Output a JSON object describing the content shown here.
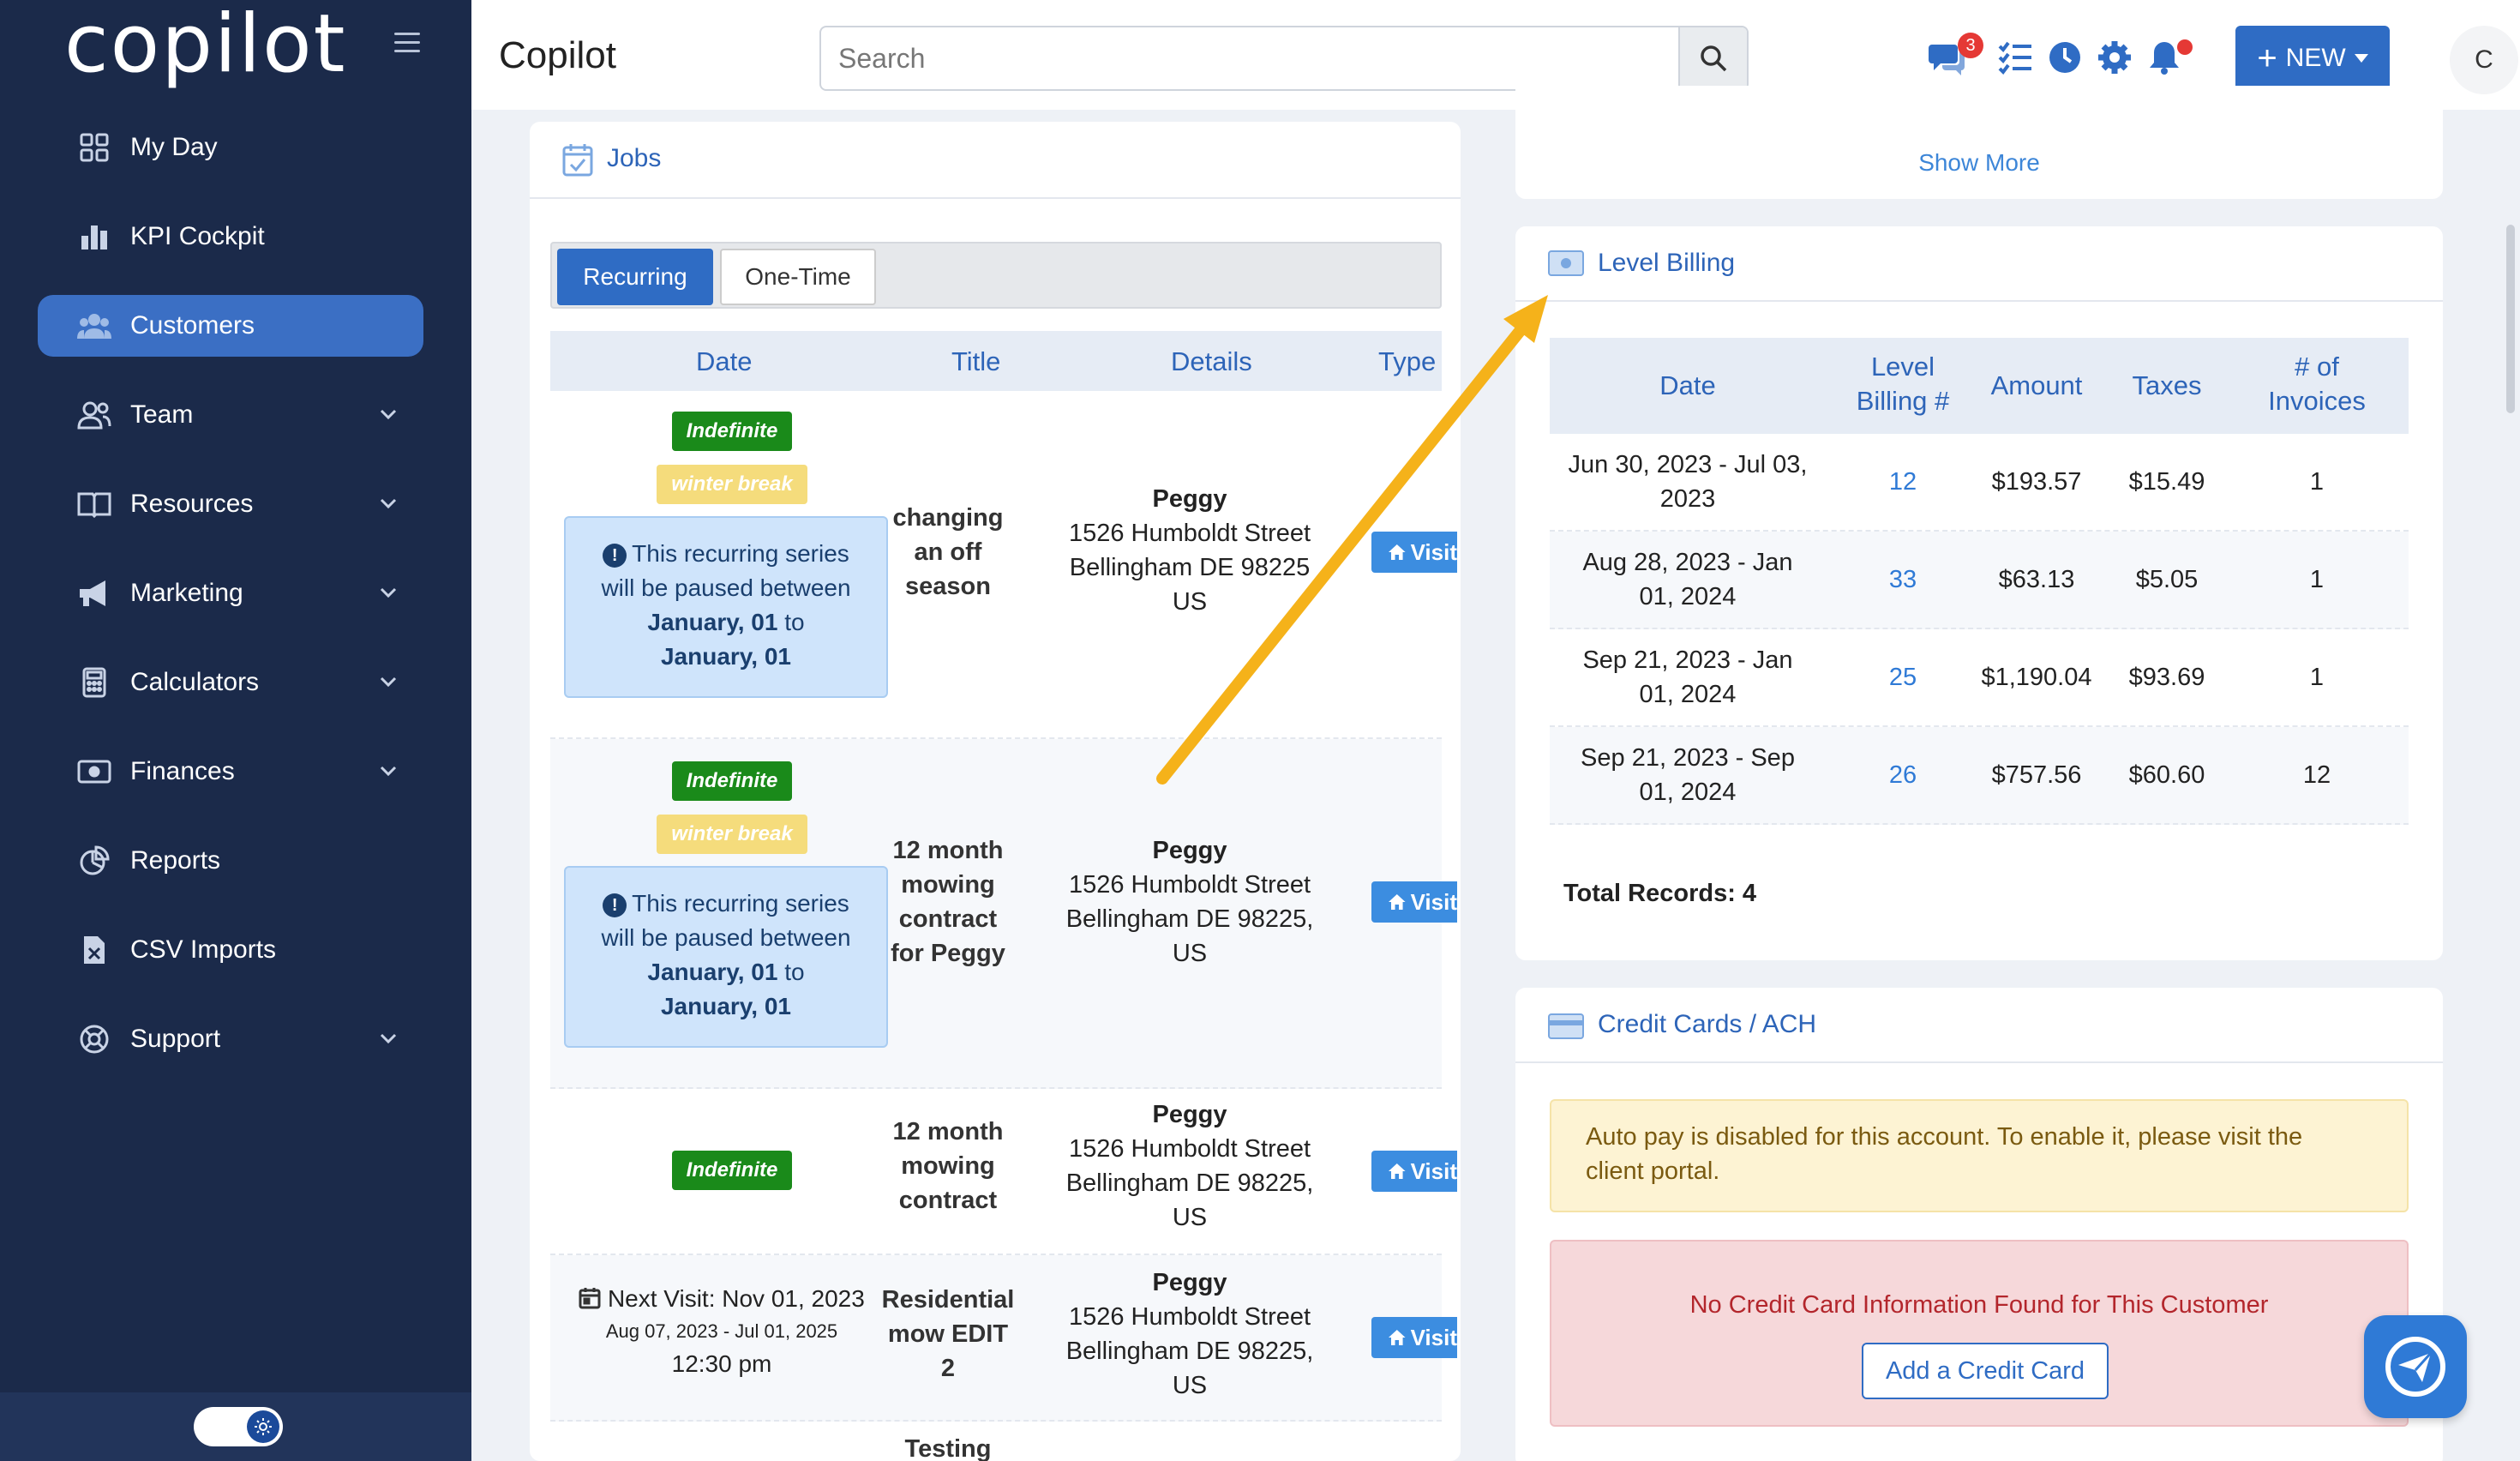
{
  "sidebar": {
    "logo": "copilot",
    "items": [
      {
        "label": "My Day"
      },
      {
        "label": "KPI Cockpit"
      },
      {
        "label": "Customers"
      },
      {
        "label": "Team"
      },
      {
        "label": "Resources"
      },
      {
        "label": "Marketing"
      },
      {
        "label": "Calculators"
      },
      {
        "label": "Finances"
      },
      {
        "label": "Reports"
      },
      {
        "label": "CSV Imports"
      },
      {
        "label": "Support"
      }
    ]
  },
  "header": {
    "title": "Copilot",
    "search_placeholder": "Search",
    "chat_badge": "3",
    "new_label": "NEW",
    "avatar": "C"
  },
  "jobs": {
    "title": "Jobs",
    "tabs": [
      "Recurring",
      "One-Time"
    ],
    "columns": [
      "Date",
      "Title",
      "Details",
      "Type"
    ],
    "rows": [
      {
        "tag": "Indefinite",
        "tag2": "winter break",
        "pause_line1": "This recurring series",
        "pause_line2": "will be paused between",
        "pause_from": "January, 01",
        "pause_to_word": "to",
        "pause_to": "January, 01",
        "title_lines": [
          "changing",
          "an off",
          "season"
        ],
        "name": "Peggy",
        "street": "1526 Humboldt Street",
        "city": "Bellingham DE 98225",
        "country": "US",
        "visit": "Visit"
      },
      {
        "tag": "Indefinite",
        "tag2": "winter break",
        "pause_line1": "This recurring series",
        "pause_line2": "will be paused between",
        "pause_from": "January, 01",
        "pause_to_word": "to",
        "pause_to": "January, 01",
        "title_lines": [
          "12 month",
          "mowing",
          "contract",
          "for Peggy"
        ],
        "name": "Peggy",
        "street": "1526 Humboldt Street",
        "city": "Bellingham DE 98225,",
        "country": "US",
        "visit": "Visit"
      },
      {
        "tag": "Indefinite",
        "title_lines": [
          "12 month",
          "mowing",
          "contract"
        ],
        "name": "Peggy",
        "street": "1526 Humboldt Street",
        "city": "Bellingham DE 98225,",
        "country": "US",
        "visit": "Visit"
      },
      {
        "next_visit": "Next Visit: Nov 01, 2023",
        "range": "Aug 07, 2023 - Jul 01, 2025",
        "time": "12:30 pm",
        "title_lines": [
          "Residential",
          "mow EDIT",
          "2"
        ],
        "name": "Peggy",
        "street": "1526 Humboldt Street",
        "city": "Bellingham DE 98225,",
        "country": "US",
        "visit": "Visit"
      },
      {
        "title_lines": [
          "Testing"
        ]
      }
    ]
  },
  "show_more": "Show More",
  "level_billing": {
    "title": "Level Billing",
    "columns": [
      "Date",
      "Level Billing #",
      "Amount",
      "Taxes",
      "# of Invoices"
    ],
    "rows": [
      {
        "date1": "Jun 30, 2023 - Jul 03,",
        "date2": "2023",
        "num": "12",
        "amount": "$193.57",
        "taxes": "$15.49",
        "invoices": "1"
      },
      {
        "date1": "Aug 28, 2023 - Jan",
        "date2": "01, 2024",
        "num": "33",
        "amount": "$63.13",
        "taxes": "$5.05",
        "invoices": "1"
      },
      {
        "date1": "Sep 21, 2023 - Jan",
        "date2": "01, 2024",
        "num": "25",
        "amount": "$1,190.04",
        "taxes": "$93.69",
        "invoices": "1"
      },
      {
        "date1": "Sep 21, 2023 - Sep",
        "date2": "01, 2024",
        "num": "26",
        "amount": "$757.56",
        "taxes": "$60.60",
        "invoices": "12"
      }
    ],
    "total": "Total Records: 4"
  },
  "credit_cards": {
    "title": "Credit Cards / ACH",
    "autopay_line1": "Auto pay is disabled for this account. To enable it, please visit the",
    "autopay_line2": "client portal.",
    "no_card": "No Credit Card Information Found for This Customer",
    "add_button": "Add a Credit Card"
  },
  "colors": {
    "sidebar": "#1b2a4a",
    "accent": "#2f6cc4",
    "annotation_arrow": "#f5b21a"
  }
}
